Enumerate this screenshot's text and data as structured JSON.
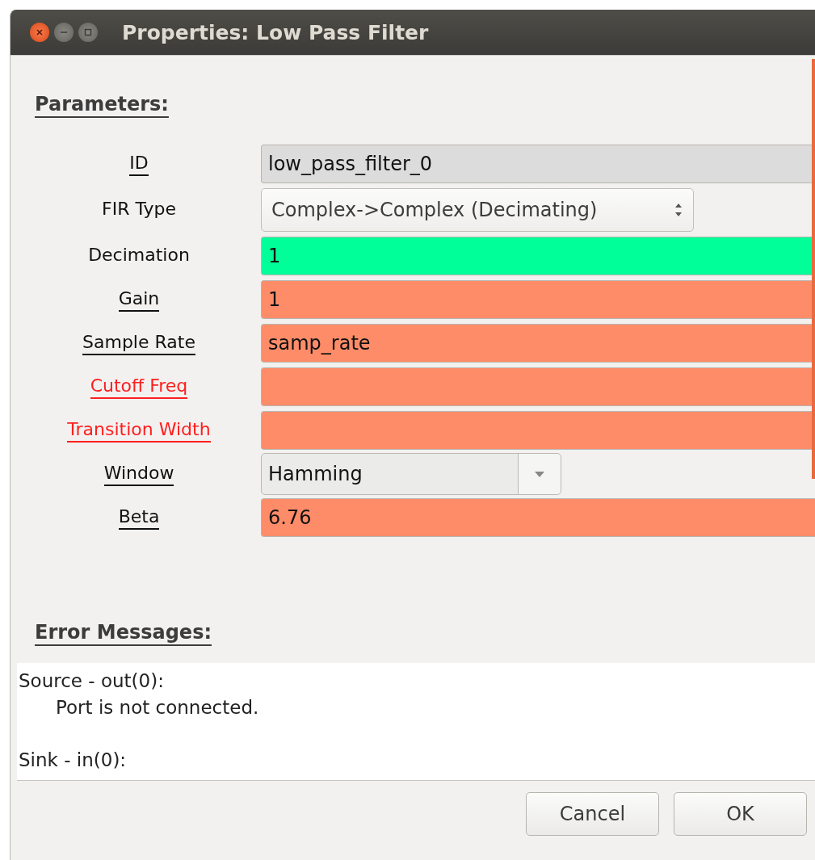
{
  "window": {
    "title": "Properties: Low Pass Filter"
  },
  "parameters_heading": "Parameters:",
  "parameters": [
    {
      "label": "ID",
      "underlined": true,
      "error": false,
      "kind": "readonly",
      "value": "low_pass_filter_0",
      "color": "#dcdcdc"
    },
    {
      "label": "FIR Type",
      "underlined": false,
      "error": false,
      "kind": "combo",
      "value": "Complex->Complex (Decimating)"
    },
    {
      "label": "Decimation",
      "underlined": false,
      "error": false,
      "kind": "text",
      "value": "1",
      "color": "#00ff99"
    },
    {
      "label": "Gain",
      "underlined": true,
      "error": false,
      "kind": "text",
      "value": "1",
      "color": "#ff8c69"
    },
    {
      "label": "Sample Rate",
      "underlined": true,
      "error": false,
      "kind": "text",
      "value": "samp_rate",
      "color": "#ff8c69"
    },
    {
      "label": "Cutoff Freq",
      "underlined": true,
      "error": true,
      "kind": "text",
      "color": "#ff8c69"
    },
    {
      "label": "Transition Width",
      "underlined": true,
      "error": true,
      "kind": "text",
      "color": "#ff8c69"
    },
    {
      "label": "Window",
      "underlined": true,
      "error": false,
      "kind": "dropdown",
      "value": "Hamming"
    },
    {
      "label": "Beta",
      "underlined": true,
      "error": false,
      "kind": "text",
      "value": "6.76",
      "color": "#ff8c69"
    }
  ],
  "errors_heading": "Error Messages:",
  "error_messages": [
    {
      "source": "Source - out(0):",
      "message": "Port is not connected."
    },
    {
      "source": "Sink - in(0):"
    }
  ],
  "buttons": [
    "Cancel",
    "OK"
  ]
}
